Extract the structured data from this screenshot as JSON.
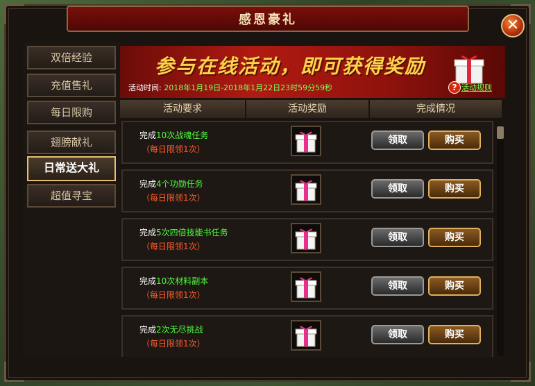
{
  "window": {
    "title": "感恩豪礼",
    "close": "✕"
  },
  "sidebar": {
    "items": [
      {
        "label": "双倍经验"
      },
      {
        "label": "充值售礼"
      },
      {
        "label": "每日限购"
      },
      {
        "label": "翅膀献礼"
      },
      {
        "label": "日常送大礼"
      },
      {
        "label": "超值寻宝"
      }
    ]
  },
  "banner": {
    "title": "参与在线活动，即可获得奖励",
    "time_label": "活动时间:",
    "time_value": "2018年1月19日-2018年1月22日23时59分59秒",
    "help_link": "活动规则",
    "help_icon": "?"
  },
  "columns": {
    "requirement": "活动要求",
    "reward": "活动奖励",
    "status": "完成情况"
  },
  "rows": [
    {
      "prefix": "完成",
      "task": "10次战魂任务",
      "limit": "（每日限领1次）",
      "claim": "领取",
      "buy": "购买"
    },
    {
      "prefix": "完成",
      "task": "4个功勋任务",
      "limit": "（每日限领1次）",
      "claim": "领取",
      "buy": "购买"
    },
    {
      "prefix": "完成",
      "task": "5次四倍技能书任务",
      "limit": "（每日限领1次）",
      "claim": "领取",
      "buy": "购买"
    },
    {
      "prefix": "完成",
      "task": "10次材料副本",
      "limit": "（每日限领1次）",
      "claim": "领取",
      "buy": "购买"
    },
    {
      "prefix": "完成",
      "task": "2次无尽挑战",
      "limit": "（每日限领1次）",
      "claim": "领取",
      "buy": "购买"
    }
  ],
  "colors": {
    "accent_green": "#4aff3a",
    "limit_red": "#ff5a2a",
    "title_gold": "#ffd24a"
  },
  "icons": {
    "reward": "gift-box-icon",
    "banner": "gift-box-icon",
    "close": "close-icon",
    "help": "help-icon"
  }
}
